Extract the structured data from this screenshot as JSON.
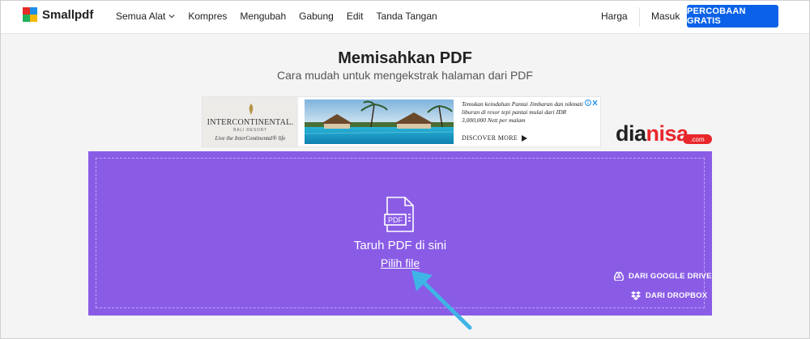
{
  "brand": {
    "name": "Smallpdf",
    "colors": [
      "#e52b26",
      "#1e8fe6",
      "#1fb05a",
      "#f5b800"
    ]
  },
  "nav": {
    "items": [
      {
        "label": "Semua Alat",
        "icon": "chevron-down-icon"
      },
      {
        "label": "Kompres"
      },
      {
        "label": "Mengubah"
      },
      {
        "label": "Gabung"
      },
      {
        "label": "Edit"
      },
      {
        "label": "Tanda Tangan"
      }
    ],
    "pricing_label": "Harga",
    "login_label": "Masuk",
    "cta_label": "PERCOBAAN GRATIS",
    "cta_color": "#0b62e8"
  },
  "page": {
    "title": "Memisahkan PDF",
    "subtitle": "Cara mudah untuk mengekstrak halaman dari PDF"
  },
  "ad": {
    "brand_name": "INTERCONTINENTAL.",
    "brand_sub": "BALI RESORT",
    "tagline": "Live the InterContinental® life",
    "text": "Temukan keindahan Pantai Jimbaran dan nikmati liburan di resor tepi pantai mulai dari IDR 3,000,000 Nett per malam",
    "discover_label": "DISCOVER MORE",
    "close_icon": "ad-close-icon"
  },
  "watermark": {
    "part1": "dia",
    "part2": "nisa",
    "badge": ".com"
  },
  "dropzone": {
    "background": "#8a5ce6",
    "drop_text": "Taruh PDF di sini",
    "choose_label": "Pilih file",
    "file_icon_label": "PDF",
    "google_drive_label": "DARI GOOGLE DRIVE",
    "dropbox_label": "DARI DROPBOX"
  },
  "annotation": {
    "arrow_color": "#3fb4e6"
  }
}
